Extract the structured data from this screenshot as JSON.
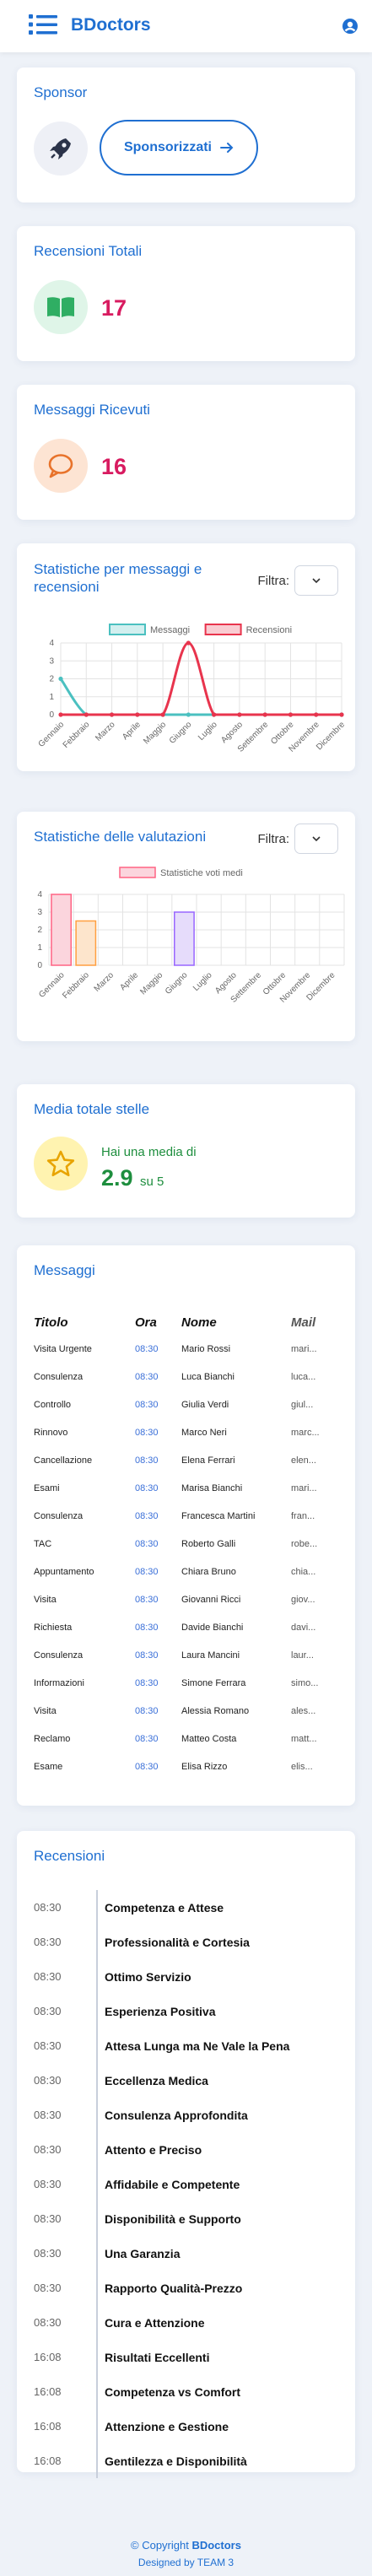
{
  "header": {
    "brand": "BDoctors",
    "menu_icon": "list-icon",
    "user_icon": "user-circle-icon"
  },
  "sponsor": {
    "title": "Sponsor",
    "icon": "rocket-icon",
    "button_label": "Sponsorizzati"
  },
  "reviews_total": {
    "title": "Recensioni Totali",
    "icon": "book-open-icon",
    "count": "17"
  },
  "messages_total": {
    "title": "Messaggi Ricevuti",
    "icon": "speech-bubble-icon",
    "count": "16"
  },
  "stats_messages": {
    "title": "Statistiche per messaggi e recensioni",
    "filter_label": "Filtra:"
  },
  "stats_ratings": {
    "title": "Statistiche delle valutazioni",
    "filter_label": "Filtra:"
  },
  "chart_data": [
    {
      "type": "line",
      "categories": [
        "Gennaio",
        "Febbraio",
        "Marzo",
        "Aprile",
        "Maggio",
        "Giugno",
        "Luglio",
        "Agosto",
        "Settembre",
        "Ottobre",
        "Novembre",
        "Dicembre"
      ],
      "series": [
        {
          "name": "Messaggi",
          "values": [
            2,
            0,
            0,
            0,
            0,
            0,
            0,
            0,
            0,
            0,
            0,
            0
          ],
          "color": "#4bc0c0"
        },
        {
          "name": "Recensioni",
          "values": [
            0,
            0,
            0,
            0,
            0,
            4,
            0,
            0,
            0,
            0,
            0,
            0
          ],
          "color": "#e8344d"
        }
      ],
      "ylim": [
        0,
        4
      ],
      "yticks": [
        "0",
        "1",
        "2",
        "3",
        "4"
      ],
      "legend": "top",
      "grid": true
    },
    {
      "type": "bar",
      "categories": [
        "Gennaio",
        "Febbraio",
        "Marzo",
        "Aprile",
        "Maggio",
        "Giugno",
        "Luglio",
        "Agosto",
        "Settembre",
        "Ottobre",
        "Novembre",
        "Dicembre"
      ],
      "series": [
        {
          "name": "Statistiche voti medi",
          "values": [
            4,
            2.5,
            0,
            0,
            0,
            3,
            0,
            0,
            0,
            0,
            0,
            0
          ]
        }
      ],
      "bar_fills": [
        "#fbd5dd",
        "#fde5cc",
        "#fff2cf",
        "#d6f0f0",
        "#d6e9fb",
        "#e6dcfb",
        "#eeeeee",
        "#fbd5dd",
        "#fde5cc",
        "#fff2cf",
        "#d6f0f0",
        "#d6e9fb"
      ],
      "bar_strokes": [
        "#ff6384",
        "#ff9f40",
        "#ffcd56",
        "#4bc0c0",
        "#36a2eb",
        "#9966ff",
        "#c9cbcf",
        "#ff6384",
        "#ff9f40",
        "#ffcd56",
        "#4bc0c0",
        "#36a2eb"
      ],
      "ylim": [
        0,
        4
      ],
      "yticks": [
        "0",
        "1",
        "2",
        "3",
        "4"
      ],
      "legend": "top",
      "grid": true
    }
  ],
  "stars": {
    "title": "Media totale stelle",
    "icon": "star-icon",
    "caption": "Hai una media di",
    "average": "2.9",
    "suffix": "su 5"
  },
  "messages": {
    "title": "Messaggi",
    "headers": [
      "Titolo",
      "Ora",
      "Nome",
      "Mail"
    ],
    "rows": [
      [
        "Visita Urgente",
        "08:30",
        "Mario Rossi",
        "mari..."
      ],
      [
        "Consulenza",
        "08:30",
        "Luca Bianchi",
        "luca..."
      ],
      [
        "Controllo",
        "08:30",
        "Giulia Verdi",
        "giul..."
      ],
      [
        "Rinnovo",
        "08:30",
        "Marco Neri",
        "marc..."
      ],
      [
        "Cancellazione",
        "08:30",
        "Elena Ferrari",
        "elen..."
      ],
      [
        "Esami",
        "08:30",
        "Marisa Bianchi",
        "mari..."
      ],
      [
        "Consulenza",
        "08:30",
        "Francesca Martini",
        "fran..."
      ],
      [
        "TAC",
        "08:30",
        "Roberto Galli",
        "robe..."
      ],
      [
        "Appuntamento",
        "08:30",
        "Chiara Bruno",
        "chia..."
      ],
      [
        "Visita",
        "08:30",
        "Giovanni Ricci",
        "giov..."
      ],
      [
        "Richiesta",
        "08:30",
        "Davide Bianchi",
        "davi..."
      ],
      [
        "Consulenza",
        "08:30",
        "Laura Mancini",
        "laur..."
      ],
      [
        "Informazioni",
        "08:30",
        "Simone Ferrara",
        "simo..."
      ],
      [
        "Visita",
        "08:30",
        "Alessia Romano",
        "ales..."
      ],
      [
        "Reclamo",
        "08:30",
        "Matteo Costa",
        "matt..."
      ],
      [
        "Esame",
        "08:30",
        "Elisa Rizzo",
        "elis..."
      ]
    ]
  },
  "reviews": {
    "title": "Recensioni",
    "items": [
      {
        "time": "08:30",
        "title": "Competenza e Attese"
      },
      {
        "time": "08:30",
        "title": "Professionalità e Cortesia"
      },
      {
        "time": "08:30",
        "title": "Ottimo Servizio"
      },
      {
        "time": "08:30",
        "title": "Esperienza Positiva"
      },
      {
        "time": "08:30",
        "title": "Attesa Lunga ma Ne Vale la Pena"
      },
      {
        "time": "08:30",
        "title": "Eccellenza Medica"
      },
      {
        "time": "08:30",
        "title": "Consulenza Approfondita"
      },
      {
        "time": "08:30",
        "title": "Attento e Preciso"
      },
      {
        "time": "08:30",
        "title": "Affidabile e Competente"
      },
      {
        "time": "08:30",
        "title": "Disponibilità e Supporto"
      },
      {
        "time": "08:30",
        "title": "Una Garanzia"
      },
      {
        "time": "08:30",
        "title": "Rapporto Qualità-Prezzo"
      },
      {
        "time": "08:30",
        "title": "Cura e Attenzione"
      },
      {
        "time": "16:08",
        "title": "Risultati Eccellenti"
      },
      {
        "time": "16:08",
        "title": "Competenza vs Comfort"
      },
      {
        "time": "16:08",
        "title": "Attenzione e Gestione"
      },
      {
        "time": "16:08",
        "title": "Gentilezza e Disponibilità"
      }
    ]
  },
  "footer": {
    "copyright": "© Copyright",
    "brand": "BDoctors",
    "designed_by": "Designed by TEAM 3"
  },
  "colors": {
    "accent": "#1f6fd1",
    "count": "#d81b60",
    "green": "#1e8e3e"
  }
}
